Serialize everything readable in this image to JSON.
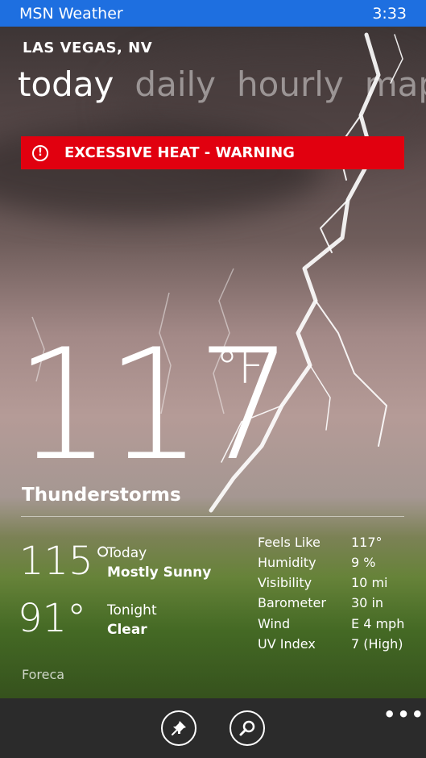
{
  "status_bar": {
    "app_name": "MSN Weather",
    "time": "3:33"
  },
  "location": "LAS VEGAS, NV",
  "pivot": {
    "tabs": [
      "today",
      "daily",
      "hourly",
      "maps"
    ],
    "active": "today"
  },
  "alert": {
    "text": "EXCESSIVE HEAT - WARNING",
    "icon": "!",
    "color": "#e1000f"
  },
  "current": {
    "temperature": "117",
    "unit": "°F",
    "condition": "Thunderstorms"
  },
  "forecast": {
    "today": {
      "temp": "115°",
      "label": "Today",
      "desc": "Mostly Sunny"
    },
    "tonight": {
      "temp": "91°",
      "label": "Tonight",
      "desc": "Clear"
    }
  },
  "details": [
    {
      "label": "Feels Like",
      "value": "117°"
    },
    {
      "label": "Humidity",
      "value": "9 %"
    },
    {
      "label": "Visibility",
      "value": "10 mi"
    },
    {
      "label": "Barometer",
      "value": "30 in"
    },
    {
      "label": "Wind",
      "value": "E 4 mph"
    },
    {
      "label": "UV Index",
      "value": "7 (High)"
    }
  ],
  "provider": "Foreca",
  "appbar": {
    "buttons": [
      "pin-icon",
      "search-icon"
    ],
    "more": "•••"
  },
  "colors": {
    "status_bar": "#1e6fe0",
    "appbar": "#2b2b2b"
  }
}
